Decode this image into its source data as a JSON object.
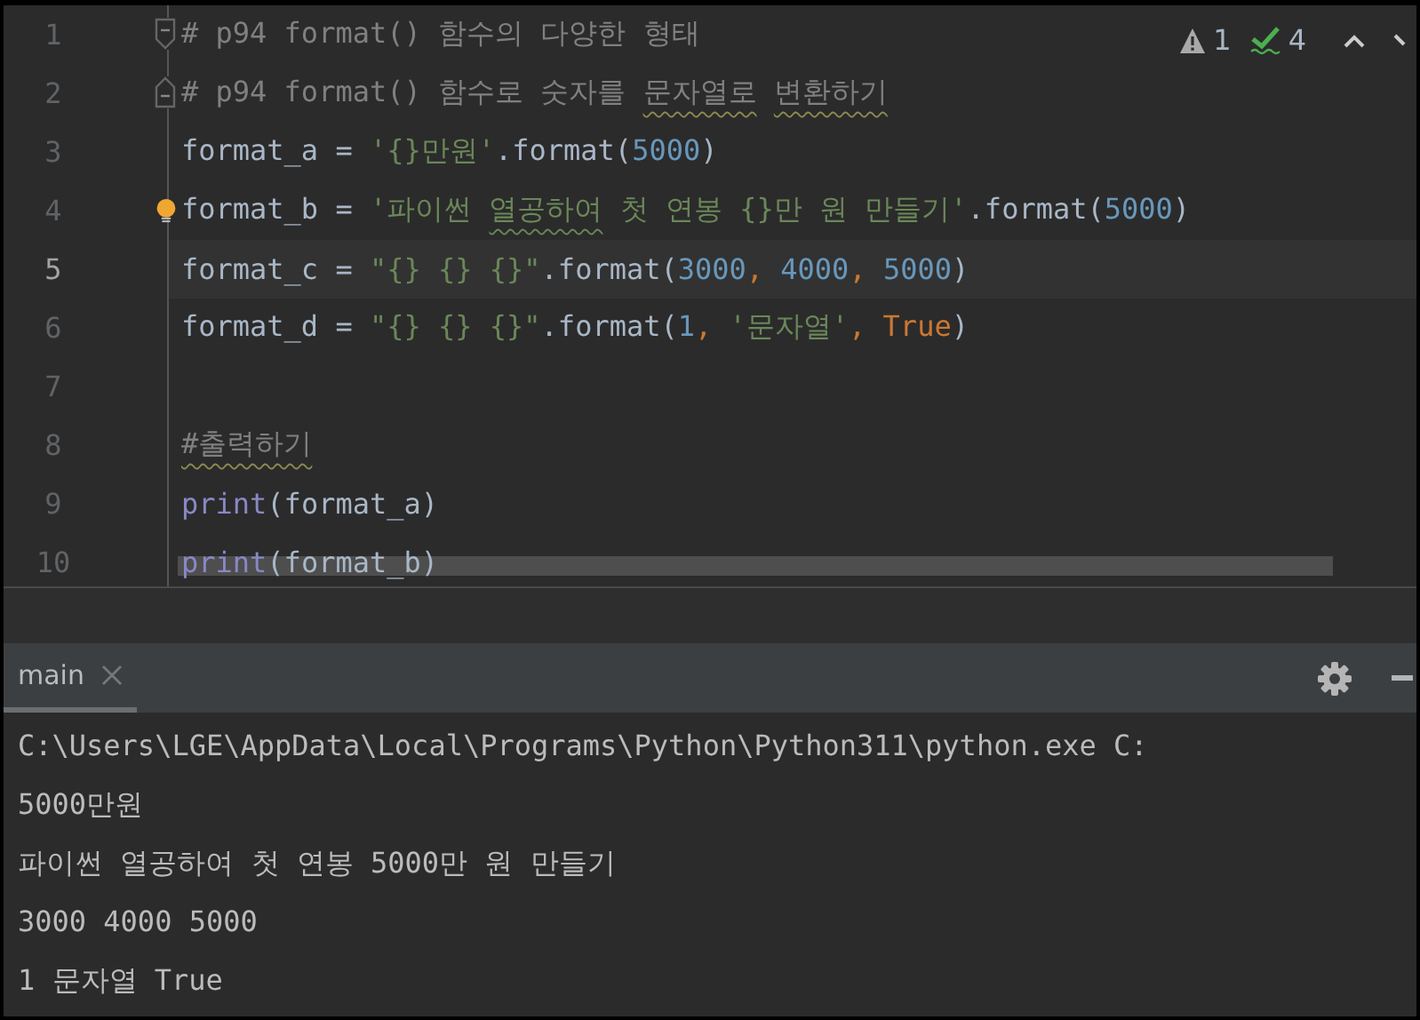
{
  "editor": {
    "inspections": {
      "warnings": "1",
      "typos": "4"
    },
    "lines": [
      {
        "number": "1",
        "current": false,
        "bulb": false,
        "kind": "fold-start",
        "tokens": [
          {
            "text": "# p94 format() 함수의 다양한 형태",
            "kind": "comment"
          }
        ]
      },
      {
        "number": "2",
        "current": false,
        "bulb": false,
        "kind": "fold-end",
        "tokens": [
          {
            "text": "# p94 format() 함수로 숫자를 ",
            "kind": "comment"
          },
          {
            "text": "문자열로",
            "kind": "typo-comment"
          },
          {
            "text": " 변환하기",
            "kind": "typo-comment"
          }
        ]
      },
      {
        "number": "3",
        "current": false,
        "bulb": false,
        "tokens": [
          {
            "text": "format_a = ",
            "kind": "plain"
          },
          {
            "text": "'{}만원'",
            "kind": "string"
          },
          {
            "text": ".format(",
            "kind": "plain"
          },
          {
            "text": "5000",
            "kind": "number"
          },
          {
            "text": ")",
            "kind": "plain"
          }
        ]
      },
      {
        "number": "4",
        "current": false,
        "bulb": true,
        "tokens": [
          {
            "text": "format_b = ",
            "kind": "plain"
          },
          {
            "text": "'파이썬 ",
            "kind": "string"
          },
          {
            "text": "열공하여",
            "kind": "typo-string"
          },
          {
            "text": " 첫 연봉 {}만 원 만들기'",
            "kind": "string"
          },
          {
            "text": ".format(",
            "kind": "plain"
          },
          {
            "text": "5000",
            "kind": "number"
          },
          {
            "text": ")",
            "kind": "plain"
          }
        ]
      },
      {
        "number": "5",
        "current": true,
        "bulb": false,
        "tokens": [
          {
            "text": "format_c = ",
            "kind": "plain"
          },
          {
            "text": "\"{} {} {}\"",
            "kind": "string"
          },
          {
            "text": ".format(",
            "kind": "plain"
          },
          {
            "text": "3000",
            "kind": "number"
          },
          {
            "text": ", ",
            "kind": "keyword"
          },
          {
            "text": "4000",
            "kind": "number"
          },
          {
            "text": ", ",
            "kind": "keyword"
          },
          {
            "text": "5000",
            "kind": "number"
          },
          {
            "text": ")",
            "kind": "plain"
          }
        ]
      },
      {
        "number": "6",
        "current": false,
        "bulb": false,
        "tokens": [
          {
            "text": "format_d = ",
            "kind": "plain"
          },
          {
            "text": "\"{} {} {}\"",
            "kind": "string"
          },
          {
            "text": ".format(",
            "kind": "plain"
          },
          {
            "text": "1",
            "kind": "number"
          },
          {
            "text": ", ",
            "kind": "keyword"
          },
          {
            "text": "'문자열'",
            "kind": "string"
          },
          {
            "text": ", ",
            "kind": "keyword"
          },
          {
            "text": "True",
            "kind": "keyword"
          },
          {
            "text": ")",
            "kind": "plain"
          }
        ]
      },
      {
        "number": "7",
        "current": false,
        "bulb": false
      },
      {
        "number": "8",
        "current": false,
        "bulb": false,
        "tokens": [
          {
            "text": "#출력하기",
            "kind": "typo-comment"
          }
        ]
      },
      {
        "number": "9",
        "current": false,
        "bulb": false,
        "tokens": [
          {
            "text": "print",
            "kind": "builtin"
          },
          {
            "text": "(format_a)",
            "kind": "plain"
          }
        ]
      },
      {
        "number": "10",
        "current": false,
        "bulb": false,
        "tokens": [
          {
            "text": "print",
            "kind": "builtin"
          },
          {
            "text": "(format_b)",
            "kind": "plain"
          }
        ]
      }
    ]
  },
  "run_panel": {
    "tabs": [
      {
        "label": "main",
        "selected": true
      }
    ],
    "output": [
      "C:\\Users\\LGE\\AppData\\Local\\Programs\\Python\\Python311\\python.exe C:",
      "5000만원",
      "파이썬 열공하여 첫 연봉 5000만 원 만들기",
      "3000 4000 5000",
      "1 문자열 True"
    ]
  }
}
